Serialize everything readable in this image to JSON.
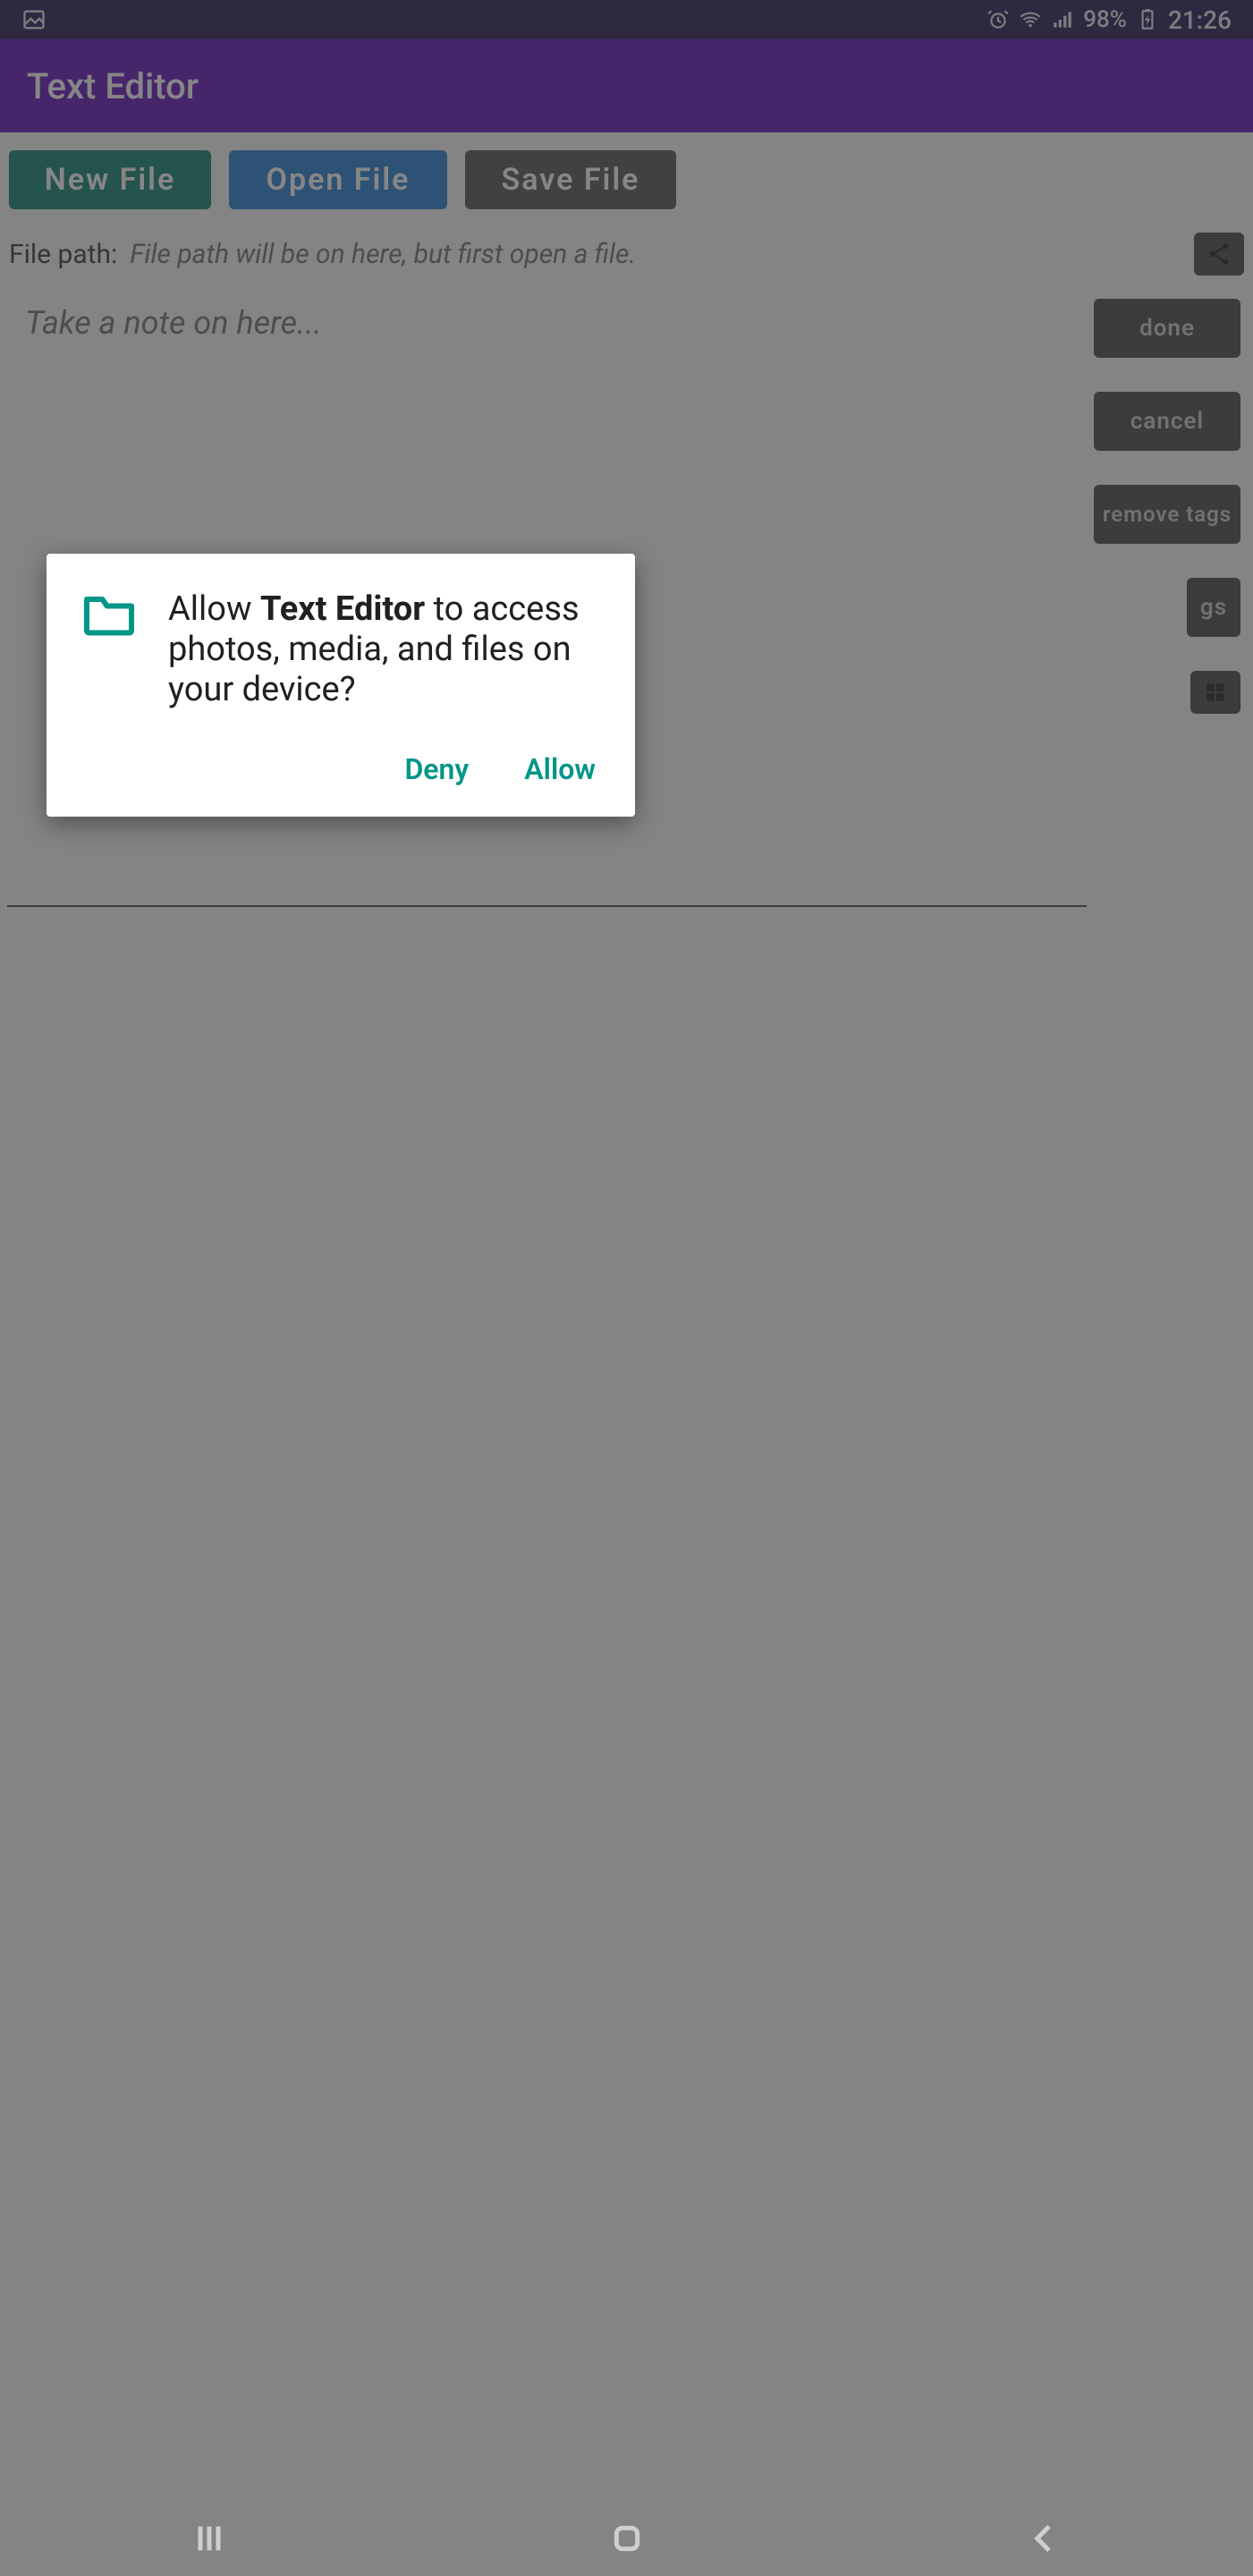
{
  "status": {
    "battery_text": "98%",
    "time": "21:26"
  },
  "appbar": {
    "title": "Text Editor"
  },
  "toolbar": {
    "new_label": "New File",
    "open_label": "Open File",
    "save_label": "Save File"
  },
  "path": {
    "label": "File path:",
    "hint": "File path will be on here, but first open a file."
  },
  "editor": {
    "placeholder": "Take a note on here..."
  },
  "side": {
    "done": "done",
    "cancel": "cancel",
    "remove_tags": "remove tags",
    "gs": "gs"
  },
  "dialog": {
    "prefix": "Allow ",
    "app_name": "Text Editor",
    "suffix": " to access photos, media, and files on your device?",
    "deny": "Deny",
    "allow": "Allow"
  }
}
